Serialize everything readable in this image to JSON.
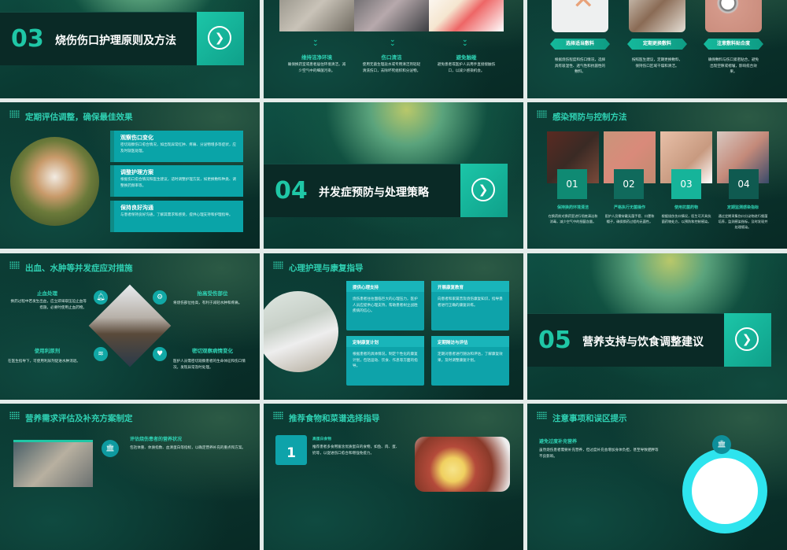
{
  "slides": {
    "s1": {
      "number": "03",
      "title": "烧伤伤口护理原则及方法"
    },
    "s2": {
      "items": [
        {
          "title": "维持洁净环境",
          "text": "确保换药室或患者居住环境清洁，减少空气中的细菌污染。"
        },
        {
          "title": "伤口清洁",
          "text": "使用无菌生理盐水或专用清洁剂轻轻清洗伤口，去除坏死组织和分泌物。"
        },
        {
          "title": "避免触碰",
          "text": "避免患者或医护人员用手直接接触伤口，以减少感染机会。"
        }
      ]
    },
    "s3": {
      "items": [
        {
          "title": "选择适当敷料",
          "text": "根据烧伤程度和伤口情况，选择具有吸湿性、透气性和抗菌性的敷料。"
        },
        {
          "title": "定期更换敷料",
          "text": "按照医生建议，定期更换敷料，保持伤口区域干燥和清洁。"
        },
        {
          "title": "注意敷料贴合度",
          "text": "确保敷料与伤口紧密贴合，避免出现空隙或褶皱，影响愈合效果。"
        }
      ]
    },
    "s4": {
      "title": "定期评估调整，确保最佳效果",
      "items": [
        {
          "title": "观察伤口变化",
          "text": "密切观察伤口愈合情况，如出现异常红肿、疼痛、分泌物增多等症状，应及时就医处理。"
        },
        {
          "title": "调整护理方案",
          "text": "根据伤口愈合情况和医生建议，适时调整护理方案，如更换敷料种类、调整换药频率等。"
        },
        {
          "title": "保持良好沟通",
          "text": "与患者保持良好沟通，了解其需求和感受，提供心理支持和护理指导。"
        }
      ]
    },
    "s5": {
      "number": "04",
      "title": "并发症预防与处理策略"
    },
    "s6": {
      "title": "感染预防与控制方法",
      "items": [
        {
          "num": "01",
          "title": "保持换药环境清洁",
          "text": "在换药前对换药室进行彻底清洁和消毒，减少空气中的细菌含量。"
        },
        {
          "num": "02",
          "title": "严格执行无菌操作",
          "text": "医护人员需穿戴无菌手套、口罩和帽子，确保换药过程的无菌性。"
        },
        {
          "num": "03",
          "title": "使用抗菌药物",
          "text": "根据烧伤伤口情况，医生可开具抗菌药物处方，以预防和控制感染。"
        },
        {
          "num": "04",
          "title": "定期监测感染指标",
          "text": "通过定期采集伤口分泌物进行细菌培养，监测感染指标，及时发现并处理感染。"
        }
      ]
    },
    "s7": {
      "title": "出血、水肿等并发症应对措施",
      "items": [
        {
          "title": "止血处理",
          "text": "换药过程中若发生出血，应立即采取压迫止血等措施，必要时使用止血药物。"
        },
        {
          "title": "抬高受伤部位",
          "text": "将烧伤部位抬高，有利于减轻水肿和疼痛。"
        },
        {
          "title": "使用利尿剂",
          "text": "在医生指导下，可使用利尿剂促进水肿消退。"
        },
        {
          "title": "密切观察病情变化",
          "text": "医护人员需密切观察患者的生命体征和伤口情况，发现异常及时处理。"
        }
      ]
    },
    "s8": {
      "title": "心理护理与康复指导",
      "items": [
        {
          "title": "提供心理支持",
          "text": "烧伤患者往往面临巨大的心理压力，医护人员应提供心理支持，帮助患者树立战胜疾病的信心。"
        },
        {
          "title": "开展康复教育",
          "text": "向患者和家属普及烧伤康复知识，指导患者进行正确的康复训练。"
        },
        {
          "title": "定制康复计划",
          "text": "根据患者的具体情况，制定个性化的康复计划，包括运动、饮食、作息等方面的指导。"
        },
        {
          "title": "定期随访与评估",
          "text": "定期对患者进行随访和评估，了解康复效果，及时调整康复计划。"
        }
      ]
    },
    "s9": {
      "number": "05",
      "title": "营养支持与饮食调整建议"
    },
    "s10": {
      "title": "营养需求评估及补充方案制定",
      "item": {
        "title": "评估烧伤患者的营养状况",
        "text": "包括体重、体质指数、血清蛋白等指标，以确定营养补充的重点和方案。"
      }
    },
    "s11": {
      "title": "推荐食物和菜谱选择指导",
      "item": {
        "num": "1",
        "title": "高蛋白食物",
        "text": "推荐患者多食用富含优质蛋白的食物，如鱼、肉、蛋、奶等，以促进伤口愈合和增强免疫力。"
      }
    },
    "s12": {
      "title": "注意事项和误区提示",
      "item": {
        "title": "避免过度补充营养",
        "text": "虽然烧伤患者需要补充营养，但过度补充会增加身体负担，甚至导致肥胖等不良影响。"
      }
    }
  },
  "colors": {
    "accent": "#1fc7a6",
    "card": "#0aa4a8",
    "dark": "#0a2a26"
  }
}
